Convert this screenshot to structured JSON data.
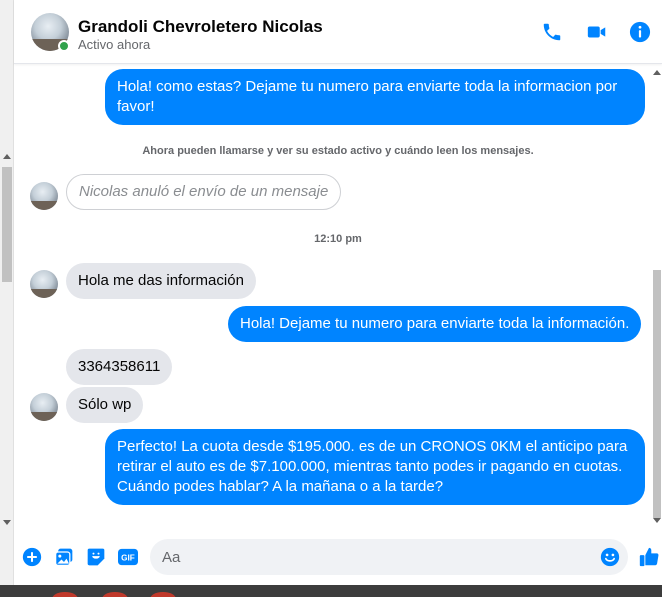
{
  "header": {
    "contact_name": "Grandoli Chevroletero Nicolas",
    "status": "Activo ahora",
    "icons": [
      "phone-icon",
      "video-camera-icon",
      "info-icon"
    ]
  },
  "conversation": {
    "msg1": "Hola! como estas? Dejame tu numero para enviarte toda la informacion por favor!",
    "system_note": "Ahora pueden llamarse y ver su estado activo y cuándo leen los mensajes.",
    "unsent_notice": "Nicolas anuló el envío de un mensaje",
    "timestamp": "12:10 pm",
    "msg2": "Hola me das información",
    "msg3": "Hola! Dejame tu numero  para enviarte toda la información.",
    "msg4": "3364358611",
    "msg5": "Sólo wp",
    "msg6": "Perfecto! La cuota desde $195.000. es de un CRONOS 0KM el anticipo para retirar el auto es de $7.100.000, mientras tanto podes ir pagando en cuotas. Cuándo podes hablar? A la mañana o a la tarde?"
  },
  "composer": {
    "placeholder": "Aa",
    "gif_label": "GIF",
    "icons": [
      "plus-icon",
      "image-icon",
      "sticker-icon",
      "gif-icon",
      "emoji-icon",
      "thumbs-up-icon"
    ]
  },
  "colors": {
    "accent": "#0084ff",
    "incoming_bubble": "#e4e6eb",
    "online": "#31a24c"
  }
}
